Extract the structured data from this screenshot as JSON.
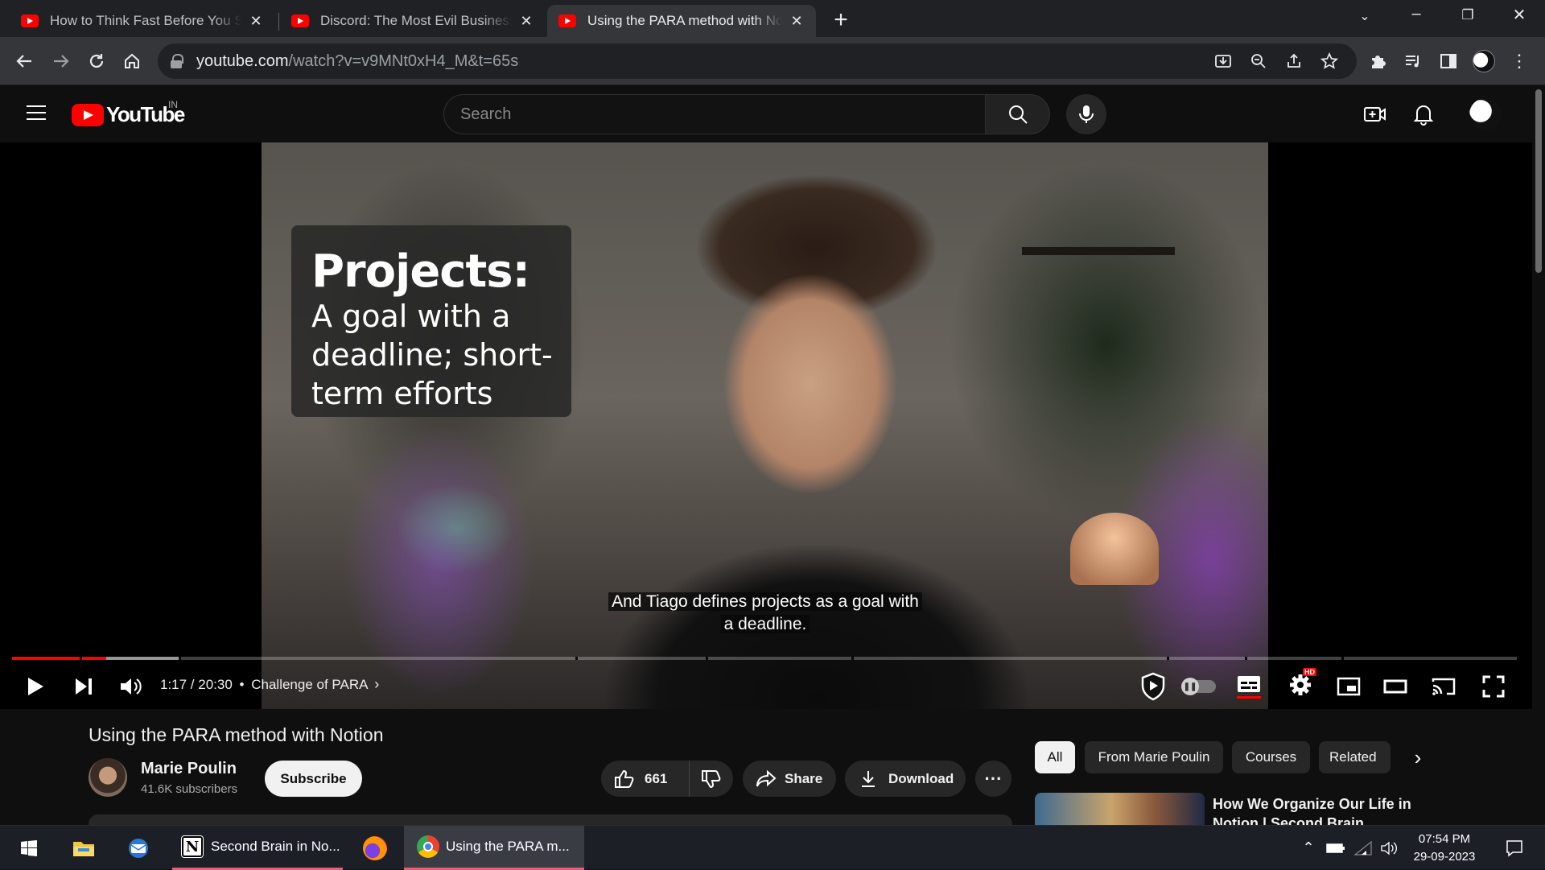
{
  "browser": {
    "tabs": [
      {
        "title": "How to Think Fast Before You Speak",
        "favicon": "youtube-icon",
        "active": false
      },
      {
        "title": "Discord: The Most Evil Business Model",
        "favicon": "youtube-icon",
        "active": false
      },
      {
        "title": "Using the PARA method with Notion",
        "favicon": "youtube-icon",
        "active": true
      }
    ],
    "url_host": "youtube.com",
    "url_path": "/watch?v=v9MNt0xH4_M&t=65s",
    "toolbar_icons": [
      "back-icon",
      "forward-icon",
      "reload-icon",
      "home-icon",
      "install-icon",
      "zoom-icon",
      "share-icon",
      "bookmark-star-icon",
      "extensions-icon",
      "media-control-icon",
      "side-panel-icon",
      "profile-avatar",
      "menu-icon"
    ]
  },
  "youtube": {
    "logo_text": "YouTube",
    "country_code": "IN",
    "search_placeholder": "Search",
    "header_icons": [
      "create-icon",
      "notifications-icon",
      "account-avatar"
    ]
  },
  "video": {
    "slide_heading": "Projects:",
    "slide_lines": [
      "A goal with a",
      "deadline; short-",
      "term efforts"
    ],
    "caption_line1": "And Tiago defines projects as a goal with",
    "caption_line2": "a deadline.",
    "time_current": "1:17",
    "time_total": "20:30",
    "time_display": "1:17 / 20:30",
    "chapter": "Challenge of PARA",
    "progress_fraction": 0.0626,
    "buffered_fraction": 0.111,
    "settings_badge": "HD",
    "accent_color": "#ff0000"
  },
  "details": {
    "title": "Using the PARA method with Notion",
    "channel_name": "Marie Poulin",
    "subscribers": "41.6K subscribers",
    "subscribe_label": "Subscribe",
    "likes": "661",
    "share_label": "Share",
    "download_label": "Download"
  },
  "sidebar": {
    "chips": [
      "All",
      "From Marie Poulin",
      "Courses",
      "Related"
    ],
    "selected_chip": "All",
    "recommended_title": "How We Organize Our Life in Notion | Second Brain"
  },
  "taskbar": {
    "apps": [
      {
        "name": "windows-start-icon"
      },
      {
        "name": "file-explorer-icon"
      },
      {
        "name": "mail-icon"
      },
      {
        "label": "Second Brain in No...",
        "icon": "notion-icon"
      },
      {
        "name": "firefox-icon"
      },
      {
        "label": "Using the PARA m...",
        "icon": "chrome-icon"
      }
    ],
    "time": "07:54 PM",
    "date": "29-09-2023"
  }
}
